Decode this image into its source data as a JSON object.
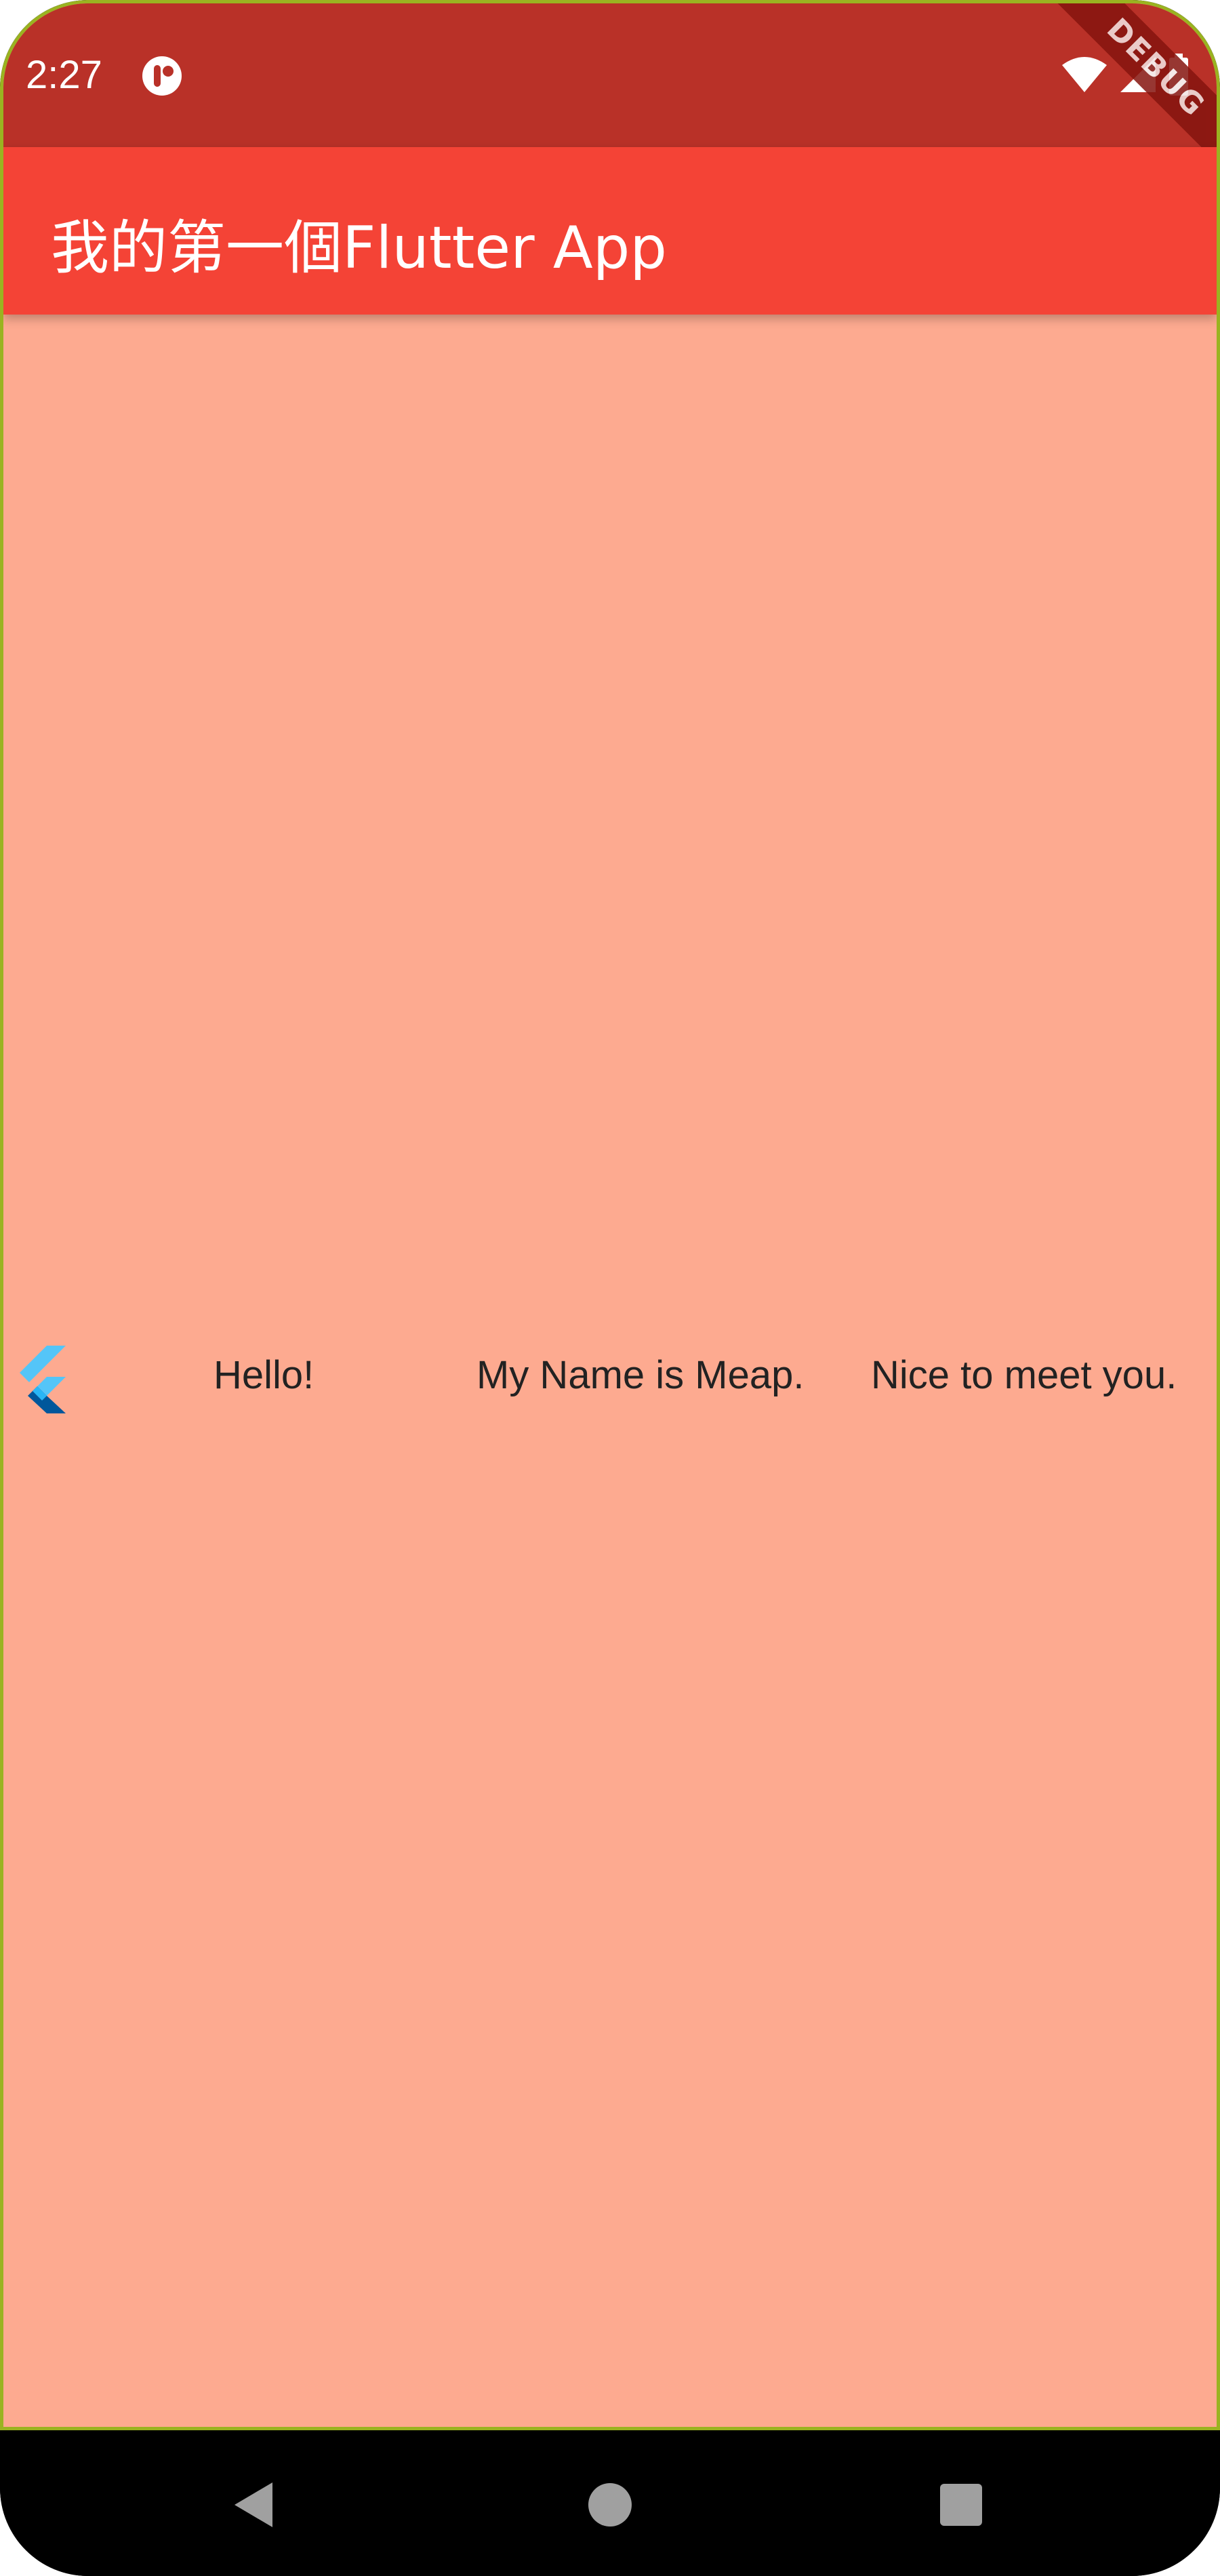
{
  "status_bar": {
    "time": "2:27",
    "app_icon": "media-app-icon",
    "wifi_icon": "wifi-icon",
    "signal_icon": "signal-icon",
    "battery_icon": "battery-icon",
    "color": "#b93128"
  },
  "debug_banner": {
    "label": "DEBUG"
  },
  "app_bar": {
    "title": "我的第一個Flutter App",
    "color": "#f44336"
  },
  "content": {
    "background": "#fdaa90",
    "logo_icon": "flutter-logo-icon",
    "texts": [
      "Hello!",
      "My Name is Meap.",
      "Nice to meet you."
    ]
  },
  "nav_bar": {
    "back_icon": "back-triangle-icon",
    "home_icon": "home-circle-icon",
    "recents_icon": "recents-square-icon"
  }
}
